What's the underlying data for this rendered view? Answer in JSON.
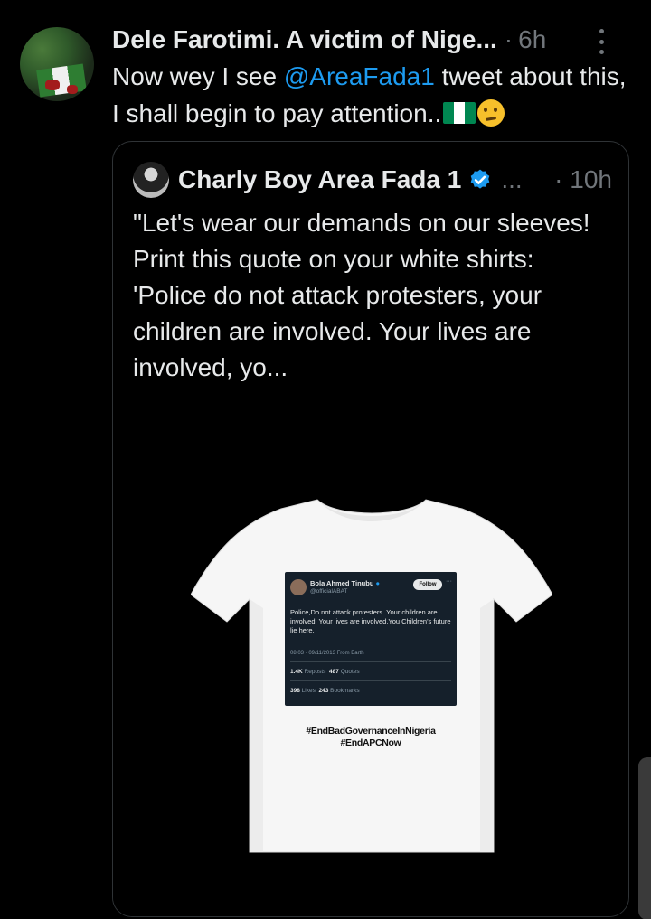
{
  "post": {
    "author_name": "Dele Farotimi. A victim of Nige...",
    "time": "6h",
    "text_before": "Now wey I see ",
    "mention": "@AreaFada1",
    "text_after": " tweet about this, I shall begin to pay attention..",
    "emoji": [
      "nigeria-flag-icon",
      "thinking-face-icon"
    ]
  },
  "quote": {
    "author_name": "Charly Boy Area Fada 1",
    "ellipsis": "...",
    "time": "10h",
    "text": "\"Let's wear our demands on our sleeves! Print this quote on your white shirts: 'Police do not attack protesters, your children are involved. Your lives are involved, yo...",
    "image": {
      "tweet_name": "Bola Ahmed Tinubu",
      "tweet_handle": "@officialABAT",
      "follow_label": "Follow",
      "tweet_text": "Police,Do not attack protesters. Your children are involved. Your lives are involved.You Children's future lie here.",
      "tweet_date": "08:03 · 09/11/2013 From Earth",
      "reposts": "1.4K",
      "reposts_label": "Reposts",
      "quotes": "487",
      "quotes_label": "Quotes",
      "likes": "398",
      "likes_label": "Likes",
      "bookmarks": "243",
      "bookmarks_label": "Bookmarks",
      "hashtag1": "#EndBadGovernanceInNigeria",
      "hashtag2": "#EndAPCNow"
    }
  },
  "colors": {
    "background": "#000000",
    "text": "#e7e9ea",
    "secondary": "#71767b",
    "link": "#1d9bf0",
    "border": "#2f3336"
  }
}
